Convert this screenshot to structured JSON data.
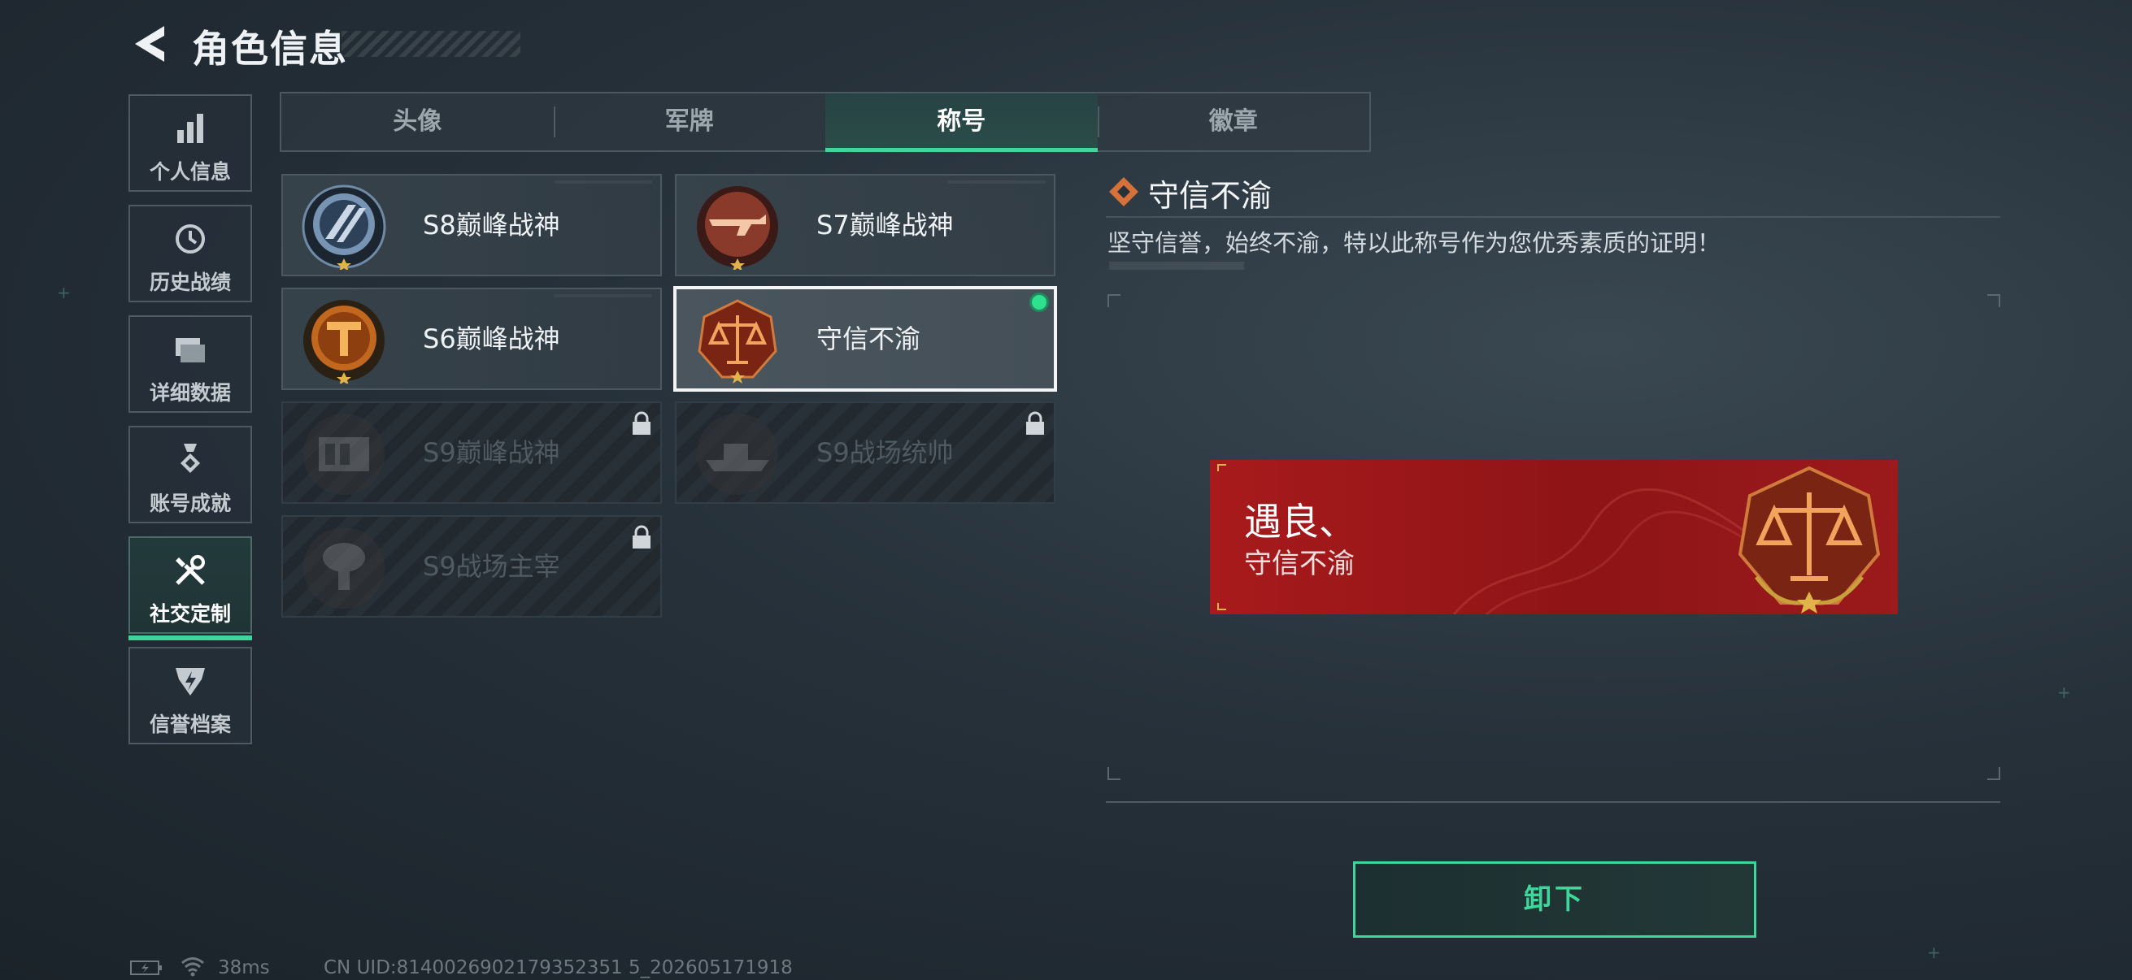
{
  "header": {
    "title": "角色信息"
  },
  "sidebar": {
    "items": [
      {
        "label": "个人信息",
        "icon": "bar-chart-icon",
        "active": false
      },
      {
        "label": "历史战绩",
        "icon": "history-clock-icon",
        "active": false
      },
      {
        "label": "详细数据",
        "icon": "folder-icon",
        "active": false
      },
      {
        "label": "账号成就",
        "icon": "achievement-medal-icon",
        "active": false
      },
      {
        "label": "社交定制",
        "icon": "tools-icon",
        "active": true
      },
      {
        "label": "信誉档案",
        "icon": "credit-shield-icon",
        "active": false
      }
    ]
  },
  "tabs": [
    {
      "label": "头像",
      "active": false
    },
    {
      "label": "军牌",
      "active": false
    },
    {
      "label": "称号",
      "active": true
    },
    {
      "label": "徽章",
      "active": false
    }
  ],
  "titles": [
    {
      "name": "S8巅峰战神",
      "locked": false,
      "selected": false,
      "emblem": "blue-stripe-emblem"
    },
    {
      "name": "S7巅峰战神",
      "locked": false,
      "selected": false,
      "emblem": "red-rifle-emblem"
    },
    {
      "name": "S6巅峰战神",
      "locked": false,
      "selected": false,
      "emblem": "orange-t-emblem"
    },
    {
      "name": "守信不渝",
      "locked": false,
      "selected": true,
      "equipped": true,
      "emblem": "scales-emblem"
    },
    {
      "name": "S9巅峰战神",
      "locked": true,
      "selected": false,
      "emblem": "fortress-emblem"
    },
    {
      "name": "S9战场统帅",
      "locked": true,
      "selected": false,
      "emblem": "warship-emblem"
    },
    {
      "name": "S9战场主宰",
      "locked": true,
      "selected": false,
      "emblem": "mushroom-cloud-emblem"
    }
  ],
  "detail": {
    "title": "守信不渝",
    "description": "坚守信誉，始终不渝，特以此称号作为您优秀素质的证明！"
  },
  "preview": {
    "player_name": "遇良、",
    "title": "守信不渝"
  },
  "action": {
    "unequip_label": "卸下"
  },
  "status": {
    "ping": "38ms",
    "uid": "CN UID:8140026902179352351 5_202605171918"
  },
  "colors": {
    "accent": "#3ed69a",
    "banner_red": "#a81a1c",
    "equipped_dot": "#2fe08e"
  }
}
